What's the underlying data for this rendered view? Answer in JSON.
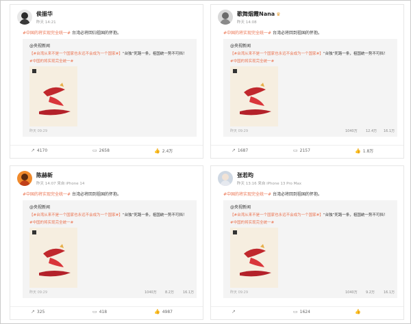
{
  "colors": {
    "accent": "#eb7350",
    "poster_red": "#c0282d",
    "poster_bg": "#f6eee0"
  },
  "posts": [
    {
      "username": "侯振华",
      "meta": "昨天 14:21",
      "hashtag": "#中国的将实现完全统一#",
      "text": "台湾必将回归祖国的怀抱。",
      "card": {
        "author": "@央视新闻",
        "line_tag": "【#台湾从来不是一个国家也永远不会成为一个国家#】",
        "line_rest": "“台独”死路一条，祖国统一势不可挡！",
        "line2": "#中国的将实现完全统一#",
        "poster_text": "统一",
        "time": "昨天 09:29",
        "stats": [
          "",
          "",
          ""
        ]
      },
      "actions": {
        "share": "4170",
        "comment": "2658",
        "like": "2.4万"
      }
    },
    {
      "username": "歌舞烟霞Nana",
      "crown": true,
      "meta": "昨天 14:08",
      "hashtag": "#中国的将实现完全统一#",
      "text": "台湾必将回到祖国的怀抱。",
      "card": {
        "author": "@央视新闻",
        "line_tag": "【#台湾从来不是一个国家也永远不会成为一个国家#】",
        "line_rest": "“台独”死路一条，祖国统一势不可挡！",
        "line2": "#中国的将实现完全统一#",
        "poster_text": "统一",
        "time": "昨天 09:29",
        "stats": [
          "1040万",
          "12.4万",
          "16.1万"
        ]
      },
      "actions": {
        "share": "1687",
        "comment": "2157",
        "like": "1.8万"
      }
    },
    {
      "username": "陈赫新",
      "meta": "昨天 14:07 来自 iPhone 14",
      "hashtag": "#中国的将实现完全统一#",
      "text": "台湾必将回到祖国的怀抱。",
      "card": {
        "author": "@央视新闻",
        "line_tag": "【#台湾从来不是一个国家也永远不会成为一个国家#】",
        "line_rest": "“台独”死路一条，祖国统一势不可挡！",
        "line2": "#中国的将实现完全统一#",
        "poster_text": "统一",
        "time": "昨天 09:29",
        "stats": [
          "1040万",
          "8.2万",
          "16.1万"
        ]
      },
      "actions": {
        "share": "325",
        "comment": "418",
        "like": "4987"
      }
    },
    {
      "username": "张若昀",
      "meta": "昨天 13:16 来自 iPhone 13 Pro Max",
      "hashtag": "#中国的将实现完全统一#",
      "text": "台湾必将回到祖国的怀抱。",
      "card": {
        "author": "@央视新闻",
        "line_tag": "【#台湾从来不是一个国家也永远不会成为一个国家#】",
        "line_rest": "“台独”死路一条，祖国统一势不可挡！",
        "line2": "#中国的将实现完全统一#",
        "poster_text": "统一",
        "time": "昨天 09:29",
        "stats": [
          "1040万",
          "9.2万",
          "16.1万"
        ]
      },
      "actions": {
        "share": "",
        "comment": "1624",
        "like": ""
      }
    }
  ]
}
